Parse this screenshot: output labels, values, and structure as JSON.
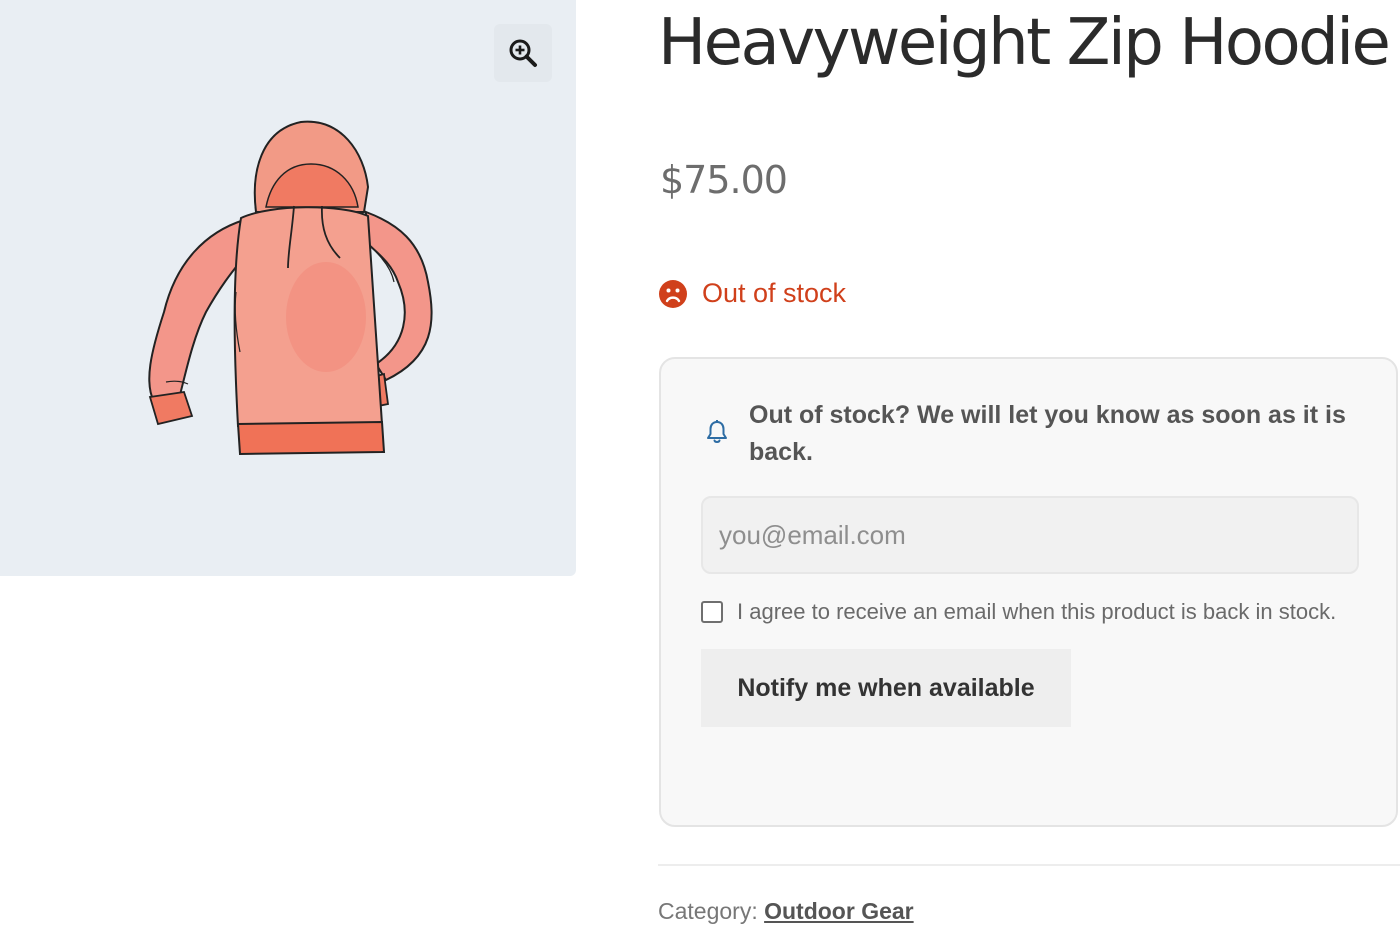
{
  "product": {
    "title": "Heavyweight Zip Hoodie",
    "price": "$75.00",
    "stock_status": "Out of stock",
    "image_alt": "Heavyweight Zip Hoodie"
  },
  "notify": {
    "message": "Out of stock? We will let you know as soon as it is back.",
    "email_placeholder": "you@email.com",
    "consent_label": "I agree to receive an email when this product is back in stock.",
    "button_label": "Notify me when available"
  },
  "meta": {
    "category_label": "Category:",
    "category_value": "Outdoor Gear"
  },
  "icons": {
    "zoom": "zoom-in-icon",
    "stock": "sad-face-icon",
    "notify": "bell-icon"
  },
  "colors": {
    "out_of_stock": "#d0401b",
    "bell": "#2e6da4",
    "hoodie": "#f08b78"
  }
}
